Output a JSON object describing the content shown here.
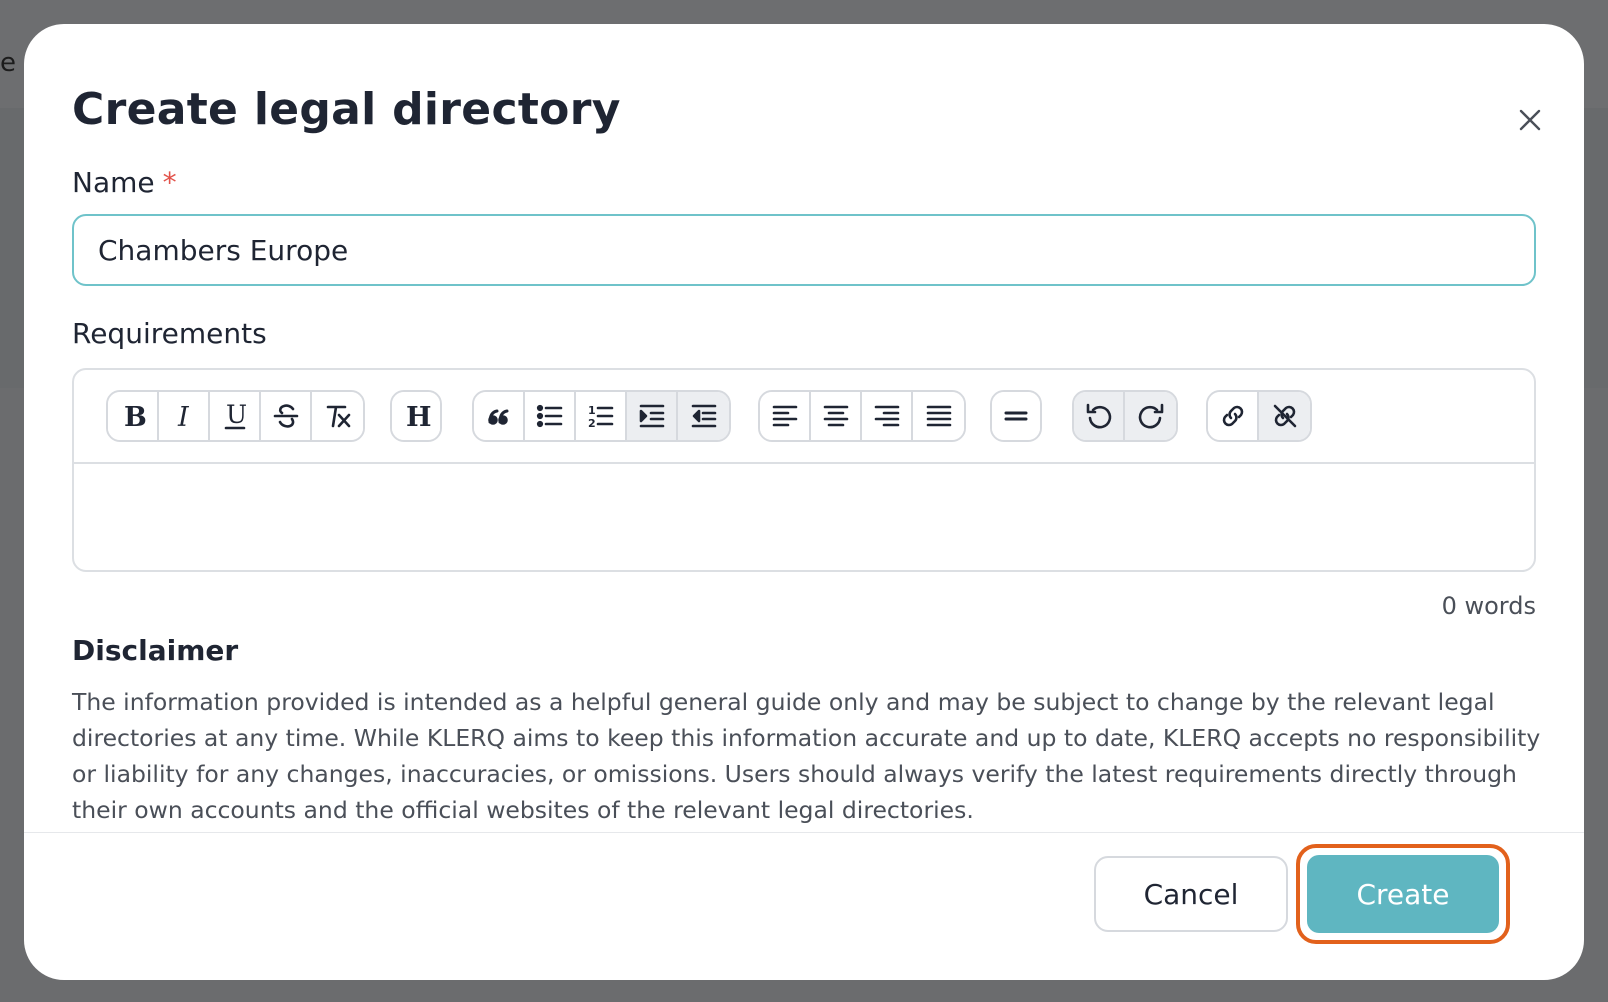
{
  "background": {
    "partial_text": "e"
  },
  "modal": {
    "title": "Create legal directory",
    "close_icon": "close-icon"
  },
  "name_field": {
    "label": "Name",
    "required_marker": "*",
    "value": "Chambers Europe"
  },
  "requirements": {
    "label": "Requirements",
    "toolbar_groups": [
      [
        "bold",
        "italic",
        "underline",
        "strikethrough",
        "clear-formatting"
      ],
      [
        "heading"
      ],
      [
        "blockquote",
        "bullet-list",
        "numbered-list",
        "indent",
        "outdent"
      ],
      [
        "align-left",
        "align-center",
        "align-right",
        "align-justify"
      ],
      [
        "horizontal-rule"
      ],
      [
        "undo",
        "redo"
      ],
      [
        "link",
        "unlink"
      ]
    ],
    "toolbar_glyphs": {
      "bold": "B",
      "italic": "I",
      "underline": "U",
      "heading": "H",
      "numbered_list_digits": [
        "1",
        "2"
      ]
    },
    "body": "",
    "word_count": "0 words"
  },
  "disclaimer": {
    "title": "Disclaimer",
    "text": "The information provided is intended as a helpful general guide only and may be subject to change by the relevant legal directories at any time. While KLERQ aims to keep this information accurate and up to date, KLERQ accepts no responsibility or liability for any changes, inaccuracies, or omissions. Users should always verify the latest requirements directly through their own accounts and the official websites of the relevant legal directories."
  },
  "footer": {
    "cancel_label": "Cancel",
    "create_label": "Create"
  },
  "colors": {
    "accent": "#5fb6c1",
    "focus_ring": "#e2611c",
    "required": "#e2524a",
    "input_focus_border": "#6fc3ca",
    "overlay": "#6b6c6e"
  }
}
